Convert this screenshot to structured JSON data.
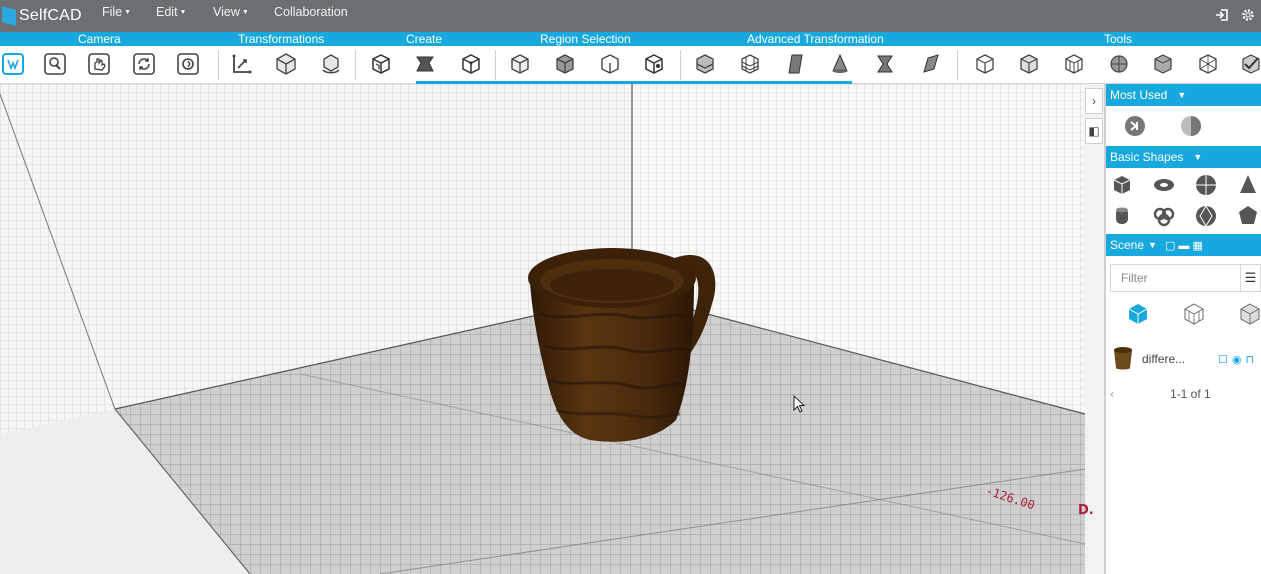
{
  "app": {
    "name": "SelfCAD"
  },
  "menu": {
    "file": "File",
    "edit": "Edit",
    "view": "View",
    "collaboration": "Collaboration"
  },
  "categories": {
    "camera": "Camera",
    "transformations": "Transformations",
    "create": "Create",
    "region_selection": "Region Selection",
    "advanced_transformation": "Advanced Transformation",
    "tools": "Tools"
  },
  "viewport": {
    "axis_label": "-126.00",
    "axis_letter": "D."
  },
  "panel": {
    "most_used": "Most Used",
    "basic_shapes": "Basic Shapes",
    "scene": "Scene",
    "filter_placeholder": "Filter",
    "object_name": "differe...",
    "pager": "1-1 of 1"
  },
  "colors": {
    "accent": "#17a9de",
    "menubar": "#6b6f71",
    "mug": "#4a2a0c",
    "axis_label": "#a8203a"
  }
}
